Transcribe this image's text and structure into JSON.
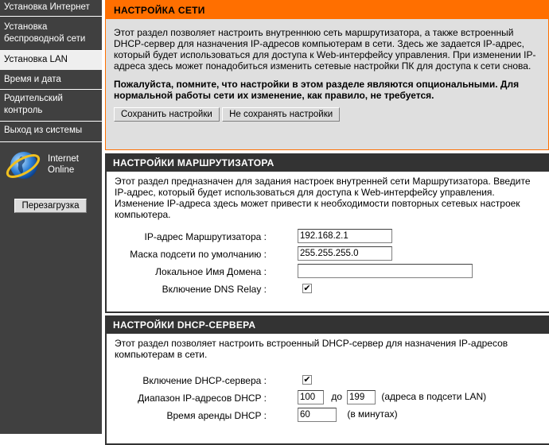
{
  "sidebar": {
    "items": [
      {
        "label": "Установка Интернет"
      },
      {
        "label": "Установка беспроводной сети"
      },
      {
        "label": "Установка LAN"
      },
      {
        "label": "Время и дата"
      },
      {
        "label": "Родительский контроль"
      },
      {
        "label": "Выход из системы"
      }
    ],
    "status_line1": "Internet",
    "status_line2": "Online",
    "reboot_label": "Перезагрузка"
  },
  "network": {
    "title": "НАСТРОЙКА СЕТИ",
    "description": "Этот раздел позволяет настроить внутреннюю сеть маршрутизатора, а также встроенный DHCP-сервер для назначения IP-адресов компьютерам в сети. Здесь же задается IP-адрес, который будет использоваться для доступа к Web-интерфейсу управления. При изменении IP-адреса здесь может понадобиться изменить сетевые настройки ПК для доступа к сети снова.",
    "note": "Пожалуйста, помните, что настройки в этом разделе являются опциональными. Для нормальной работы сети их изменение, как правило, не требуется.",
    "save_label": "Сохранить настройки",
    "dont_save_label": "Не сохранять настройки"
  },
  "router": {
    "title": "НАСТРОЙКИ МАРШРУТИЗАТОРА",
    "description": "Этот раздел предназначен для задания настроек внутренней сети Маршрутизатора. Введите IP-адрес, который будет использоваться для доступа к Web-интерфейсу управления. Изменение IP-адреса здесь может привести к необходимости повторных сетевых настроек компьютера.",
    "ip_label": "IP-адрес Маршрутизатора :",
    "ip_value": "192.168.2.1",
    "mask_label": "Маска подсети по умолчанию :",
    "mask_value": "255.255.255.0",
    "domain_label": "Локальное Имя Домена :",
    "domain_value": "",
    "dns_relay_label": "Включение DNS Relay :",
    "dns_relay_checked": true
  },
  "dhcp": {
    "title": "НАСТРОЙКИ DHCP-СЕРВЕРА",
    "description": "Этот раздел позволяет настроить встроенный DHCP-сервер для назначения IP-адресов компьютерам в сети.",
    "enable_label": "Включение DHCP-сервера :",
    "enable_checked": true,
    "range_label": "Диапазон IP-адресов DHCP :",
    "range_start": "100",
    "range_to": "до",
    "range_end": "199",
    "range_note": "(адреса в подсети LAN)",
    "lease_label": "Время аренды DHCP :",
    "lease_value": "60",
    "lease_note": "(в минутах)"
  }
}
